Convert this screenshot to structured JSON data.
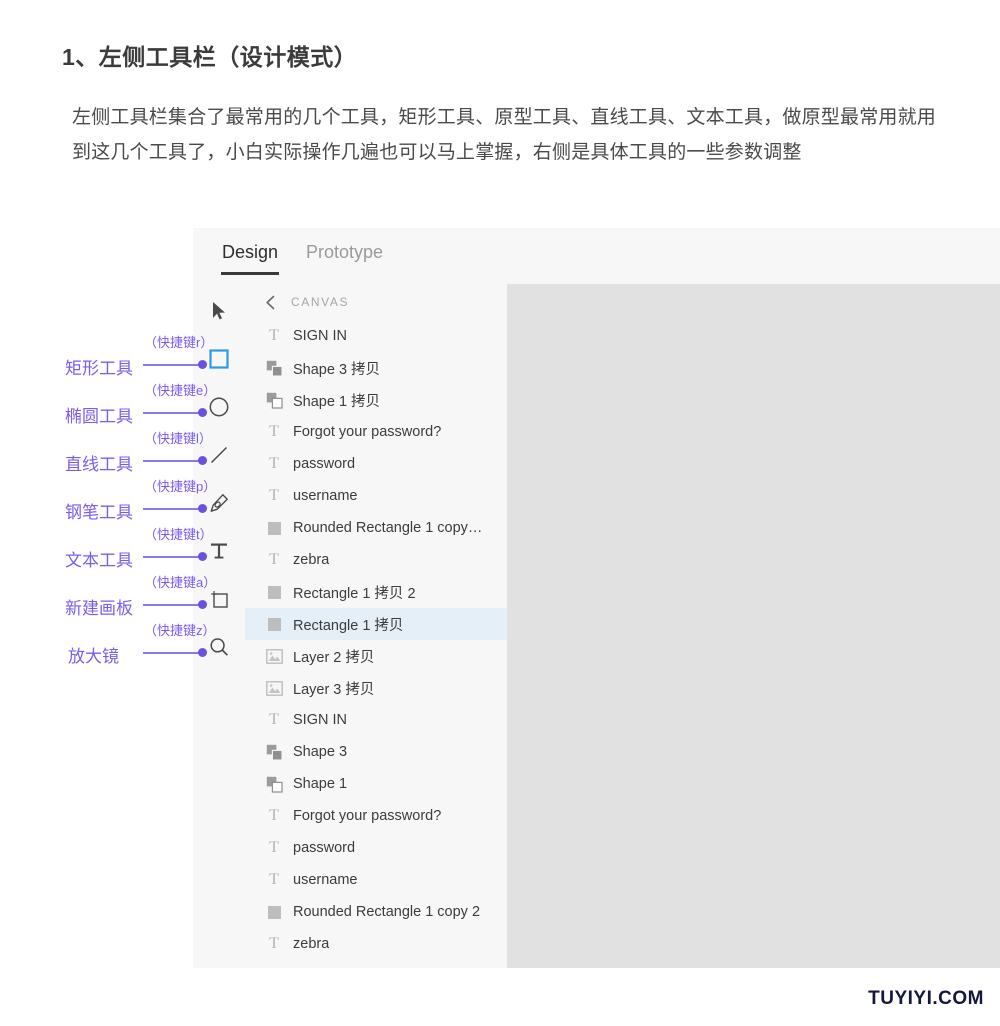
{
  "article": {
    "heading": "1、左侧工具栏（设计模式）",
    "paragraph": "左侧工具栏集合了最常用的几个工具，矩形工具、原型工具、直线工具、文本工具，做原型最常用就用到这几个工具了，小白实际操作几遍也可以马上掌握，右侧是具体工具的一些参数调整"
  },
  "app": {
    "tabs": [
      {
        "label": "Design",
        "active": true
      },
      {
        "label": "Prototype",
        "active": false
      }
    ],
    "toolbar": {
      "tools": [
        {
          "name": "move-tool",
          "icon": "cursor-arrow-icon",
          "selected": false
        },
        {
          "name": "rectangle-tool",
          "icon": "rectangle-icon",
          "selected": true
        },
        {
          "name": "ellipse-tool",
          "icon": "ellipse-icon",
          "selected": false
        },
        {
          "name": "line-tool",
          "icon": "line-icon",
          "selected": false
        },
        {
          "name": "pen-tool",
          "icon": "pen-icon",
          "selected": false
        },
        {
          "name": "text-tool",
          "icon": "text-t-icon",
          "selected": false
        },
        {
          "name": "artboard-tool",
          "icon": "artboard-icon",
          "selected": false
        },
        {
          "name": "zoom-tool",
          "icon": "magnifier-icon",
          "selected": false
        }
      ]
    },
    "layer_panel": {
      "header": {
        "back_icon": "chevron-left-icon",
        "title": "CANVAS"
      },
      "layers": [
        {
          "label": "SIGN IN",
          "icon": "text-layer-icon",
          "selected": false
        },
        {
          "label": "Shape 3 拷贝",
          "icon": "shape-filled-icon",
          "selected": false
        },
        {
          "label": "Shape 1 拷贝",
          "icon": "shape-outline-icon",
          "selected": false
        },
        {
          "label": "Forgot your password?",
          "icon": "text-layer-icon",
          "selected": false
        },
        {
          "label": "password",
          "icon": "text-layer-icon",
          "selected": false
        },
        {
          "label": "username",
          "icon": "text-layer-icon",
          "selected": false
        },
        {
          "label": "Rounded Rectangle 1 copy…",
          "icon": "rectangle-layer-icon",
          "selected": false
        },
        {
          "label": "zebra",
          "icon": "text-layer-icon",
          "selected": false
        },
        {
          "label": "Rectangle 1 拷贝 2",
          "icon": "rectangle-layer-icon",
          "selected": false
        },
        {
          "label": "Rectangle 1 拷贝",
          "icon": "rectangle-layer-icon",
          "selected": true
        },
        {
          "label": "Layer 2 拷贝",
          "icon": "image-layer-icon",
          "selected": false
        },
        {
          "label": "Layer 3 拷贝",
          "icon": "image-layer-icon",
          "selected": false
        },
        {
          "label": "SIGN IN",
          "icon": "text-layer-icon",
          "selected": false
        },
        {
          "label": "Shape 3",
          "icon": "shape-filled-icon",
          "selected": false
        },
        {
          "label": "Shape 1",
          "icon": "shape-outline-icon",
          "selected": false
        },
        {
          "label": "Forgot your password?",
          "icon": "text-layer-icon",
          "selected": false
        },
        {
          "label": "password",
          "icon": "text-layer-icon",
          "selected": false
        },
        {
          "label": "username",
          "icon": "text-layer-icon",
          "selected": false
        },
        {
          "label": "Rounded Rectangle 1 copy 2",
          "icon": "rectangle-layer-icon",
          "selected": false
        },
        {
          "label": "zebra",
          "icon": "text-layer-icon",
          "selected": false
        }
      ]
    }
  },
  "annotations": [
    {
      "name": "rectangle-tool",
      "label": "矩形工具",
      "shortcut": "（快捷键r）"
    },
    {
      "name": "ellipse-tool",
      "label": "椭圆工具",
      "shortcut": "（快捷键e）"
    },
    {
      "name": "line-tool",
      "label": "直线工具",
      "shortcut": "（快捷键l）"
    },
    {
      "name": "pen-tool",
      "label": "钢笔工具",
      "shortcut": "（快捷键p）"
    },
    {
      "name": "text-tool",
      "label": "文本工具",
      "shortcut": "（快捷键t）"
    },
    {
      "name": "artboard-tool",
      "label": "新建画板",
      "shortcut": "（快捷键a）"
    },
    {
      "name": "zoom-tool",
      "label": "放大镜",
      "shortcut": "（快捷键z）"
    }
  ],
  "watermark": "TUYIYI.COM",
  "colors": {
    "annotation_purple": "#7a5cf0",
    "selected_row": "#e4eff7",
    "selected_tool_outline": "#2f9ae0",
    "canvas_gray": "#e1e1e1",
    "watermark": "#13183c"
  }
}
